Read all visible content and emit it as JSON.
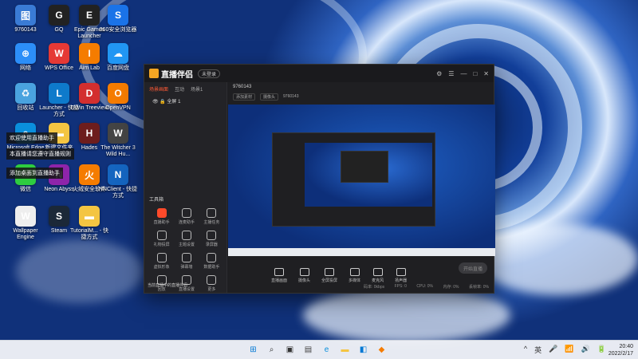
{
  "desktop": {
    "icons": [
      {
        "label": "9760143",
        "color": "#3a7bd5",
        "glyph": "图"
      },
      {
        "label": "GQ",
        "color": "#222",
        "glyph": "G"
      },
      {
        "label": "Epic Games Launcher",
        "color": "#222",
        "glyph": "E"
      },
      {
        "label": "360安全浏览器",
        "color": "#1a73e8",
        "glyph": "S"
      },
      {
        "label": "网络",
        "color": "#2c8ef8",
        "glyph": "⊕"
      },
      {
        "label": "WPS Office",
        "color": "#e53935",
        "glyph": "W"
      },
      {
        "label": "Aim Lab",
        "color": "#f57c00",
        "glyph": "I"
      },
      {
        "label": "百度网盘",
        "color": "#2196f3",
        "glyph": "☁"
      },
      {
        "label": "回收站",
        "color": "#4aa3df",
        "glyph": "♻"
      },
      {
        "label": "Launcher - 快捷方式",
        "color": "#0e7acb",
        "glyph": "L"
      },
      {
        "label": "DWin Treeview",
        "color": "#d32f2f",
        "glyph": "D"
      },
      {
        "label": "OpenVPN",
        "color": "#f57c00",
        "glyph": "O"
      },
      {
        "label": "Microsoft Edge",
        "color": "#0a8fdc",
        "glyph": "e"
      },
      {
        "label": "新建文件夹",
        "color": "#f4c542",
        "glyph": "▬"
      },
      {
        "label": "Hades",
        "color": "#6d1d1d",
        "glyph": "H"
      },
      {
        "label": "The Witcher 3 Wild Hu...",
        "color": "#444",
        "glyph": "W"
      },
      {
        "label": "微信",
        "color": "#2ecc40",
        "glyph": "✉"
      },
      {
        "label": "Neon Abyss",
        "color": "#8e24aa",
        "glyph": "N"
      },
      {
        "label": "火绒安全软件",
        "color": "#f57c00",
        "glyph": "火"
      },
      {
        "label": "NNClient - 快捷方式",
        "color": "#1565c0",
        "glyph": "N"
      },
      {
        "label": "Wallpaper Engine",
        "color": "#eee",
        "glyph": "W"
      },
      {
        "label": "Steam",
        "color": "#1b2838",
        "glyph": "S"
      },
      {
        "label": "TutorialM... - 快捷方式",
        "color": "#f4c542",
        "glyph": "▬"
      }
    ],
    "sticky1": "欢迎使用直播助手",
    "sticky2": "本直播请您遵守直播规则",
    "sticky3": "添加桌面到直播助手"
  },
  "app": {
    "title": "直播伴侣",
    "badge": "未登录",
    "tabs": [
      "场景画面",
      "互动",
      "场景1"
    ],
    "scene_name": "全屏 1",
    "room_id": "9760143",
    "info_tags": [
      "添加素材",
      "摄像头",
      "9760143"
    ],
    "tools_title": "工具箱",
    "tools": [
      "直播助手",
      "连麦助手",
      "主播任务",
      "礼物投屏",
      "主题设置",
      "录屏器",
      "虚拟形象",
      "弹幕墙",
      "数据助手",
      "回放",
      "直播设置",
      "更多"
    ],
    "bottom_status": "当前直播中的直播伴侣",
    "controls": [
      "直播画面",
      "摄像头",
      "全屏投屏",
      "多媒体",
      "麦克风",
      "扬声器"
    ],
    "start_button": "开始直播",
    "stats": [
      "码率: 0kbps",
      "FPS: 0",
      "CPU: 0%",
      "内存: 0%",
      "丢帧率: 0%"
    ]
  },
  "taskbar": {
    "icons": [
      {
        "name": "start",
        "glyph": "⊞",
        "color": "#0078d4"
      },
      {
        "name": "search",
        "glyph": "⌕",
        "color": "#333"
      },
      {
        "name": "task-view",
        "glyph": "▣",
        "color": "#333"
      },
      {
        "name": "store",
        "glyph": "▤",
        "color": "#444"
      },
      {
        "name": "edge",
        "glyph": "e",
        "color": "#0a8fdc"
      },
      {
        "name": "explorer",
        "glyph": "▬",
        "color": "#f4c542"
      },
      {
        "name": "app-store",
        "glyph": "◧",
        "color": "#0078d4"
      },
      {
        "name": "live-companion",
        "glyph": "◆",
        "color": "#f57c00"
      }
    ],
    "tray": [
      "^",
      "英",
      "🎤",
      "📶",
      "🔊",
      "🔋"
    ],
    "time": "20:40",
    "date": "2022/2/17"
  }
}
